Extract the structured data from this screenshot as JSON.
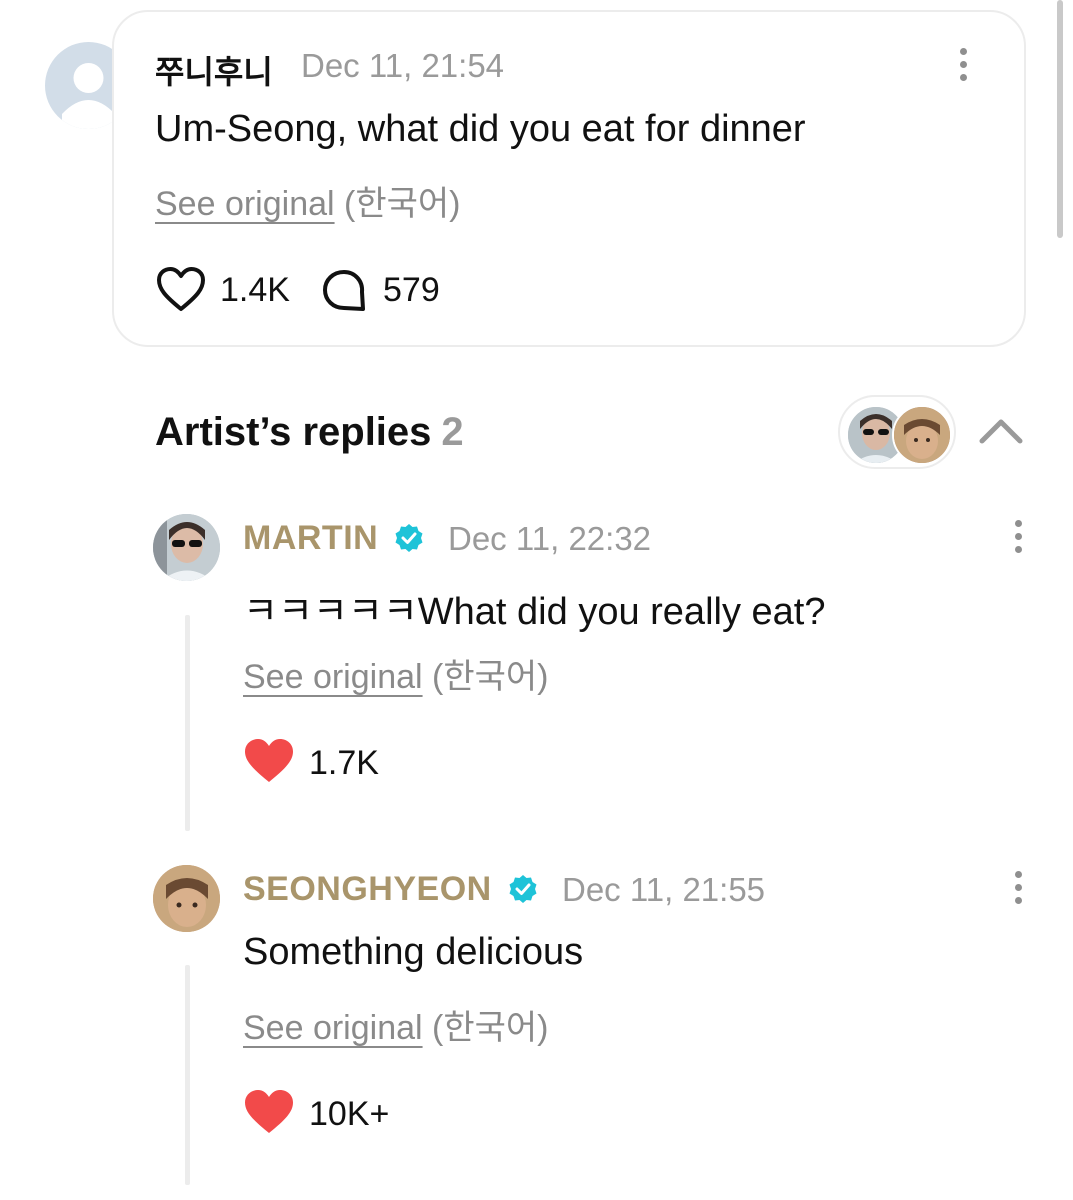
{
  "comment": {
    "author": "쭈니후니",
    "date": "Dec 11, 21:54",
    "text": "Um-Seong, what did you eat for dinner",
    "see_original": "See original",
    "original_lang": "(한국어)",
    "likes": "1.4K",
    "replies": "579"
  },
  "artist_replies": {
    "title": "Artist’s replies",
    "count": "2",
    "items": [
      {
        "author": "MARTIN",
        "date": "Dec 11, 22:32",
        "text": "ㅋㅋㅋㅋㅋWhat did you really eat?",
        "see_original": "See original",
        "original_lang": "(한국어)",
        "likes": "1.7K"
      },
      {
        "author": "SEONGHYEON",
        "date": "Dec 11, 21:55",
        "text": "Something delicious",
        "see_original": "See original",
        "original_lang": "(한국어)",
        "likes": "10K+"
      }
    ]
  },
  "colors": {
    "artist_name": "#a9956b",
    "verified_badge": "#1ec3d8",
    "liked_heart": "#f24a4a",
    "muted_text": "#9a9a9a"
  },
  "icons": [
    "more-vertical-icon",
    "heart-outline-icon",
    "comment-bubble-icon",
    "heart-filled-icon",
    "verified-badge-icon",
    "chevron-up-icon",
    "default-avatar-icon"
  ]
}
